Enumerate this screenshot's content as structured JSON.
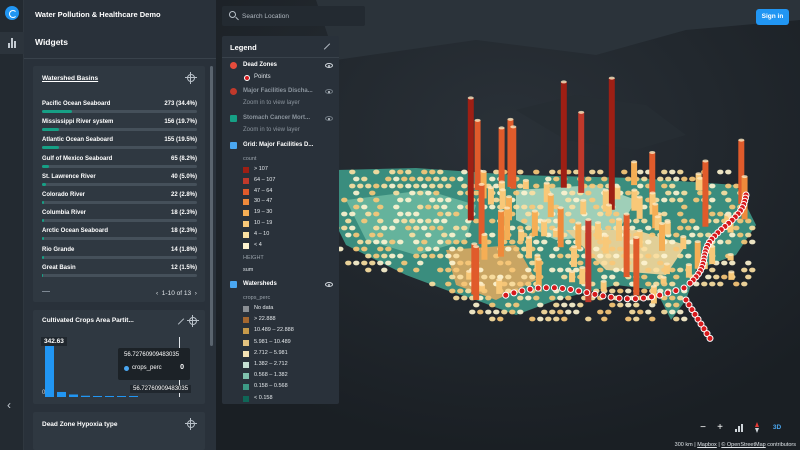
{
  "app": {
    "title": "Water Pollution & Healthcare Demo",
    "widgets_title": "Widgets"
  },
  "rail": {
    "collapse_icon": "chevron-left-icon"
  },
  "watershed": {
    "title": "Watershed Basins",
    "rows": [
      {
        "name": "Pacific Ocean Seaboard",
        "value": "273 (34.4%)",
        "fraction": 0.344
      },
      {
        "name": "Mississippi River system",
        "value": "156 (19.7%)",
        "fraction": 0.197
      },
      {
        "name": "Atlantic Ocean Seaboard",
        "value": "155 (19.5%)",
        "fraction": 0.195
      },
      {
        "name": "Gulf of Mexico Seaboard",
        "value": "65 (8.2%)",
        "fraction": 0.082
      },
      {
        "name": "St. Lawrence River",
        "value": "40 (5.0%)",
        "fraction": 0.05
      },
      {
        "name": "Colorado River",
        "value": "22 (2.8%)",
        "fraction": 0.028
      },
      {
        "name": "Columbia River",
        "value": "18 (2.3%)",
        "fraction": 0.023
      },
      {
        "name": "Arctic Ocean Seaboard",
        "value": "18 (2.3%)",
        "fraction": 0.023
      },
      {
        "name": "Rio Grande",
        "value": "14 (1.8%)",
        "fraction": 0.018
      },
      {
        "name": "Great Basin",
        "value": "12 (1.5%)",
        "fraction": 0.015
      }
    ],
    "pager": "1-10 of 13",
    "prev": "‹",
    "next": "›"
  },
  "cultivated": {
    "title": "Cultivated Crops Area Partit...",
    "max_label": "342.63",
    "min_label": "0",
    "histogram": [
      0.62,
      0.06,
      0.03,
      0.015,
      0.01,
      0.006,
      0.004,
      0.003
    ],
    "tooltip_title": "56.72760909483035",
    "tooltip_series": "crops_perc",
    "tooltip_value": "0",
    "cursor_label": "56.72760909483035"
  },
  "dead_zone": {
    "title": "Dead Zone Hypoxia type"
  },
  "search": {
    "placeholder": "Search Location"
  },
  "signin": "Sign in",
  "legend": {
    "title": "Legend",
    "dead_zones": {
      "name": "Dead Zones",
      "point_label": "Points",
      "color": "#d7191c"
    },
    "major_facilities": {
      "name": "Major Facilities Discha...",
      "note": "Zoom in to view layer"
    },
    "stomach_cancer": {
      "name": "Stomach Cancer Mort...",
      "note": "Zoom in to view layer"
    },
    "grid": {
      "name": "Grid: Major Facilities D...",
      "count_label": "count",
      "height_label": "HEIGHT",
      "height_value": "sum",
      "bins": [
        {
          "label": "> 107",
          "color": "#9e1f14"
        },
        {
          "label": "64 – 107",
          "color": "#c0392b"
        },
        {
          "label": "47 – 64",
          "color": "#e05b2b"
        },
        {
          "label": "30 – 47",
          "color": "#ef8a3b"
        },
        {
          "label": "19 – 30",
          "color": "#f5ae55"
        },
        {
          "label": "10 – 19",
          "color": "#f8c878"
        },
        {
          "label": "4 – 10",
          "color": "#fbe0a2"
        },
        {
          "label": "< 4",
          "color": "#fdf3cf"
        }
      ]
    },
    "watersheds": {
      "name": "Watersheds",
      "field": "crops_perc",
      "bins": [
        {
          "label": "No data",
          "color": "#8a8f94"
        },
        {
          "label": "> 22.888",
          "color": "#a4672f"
        },
        {
          "label": "10.489 – 22.888",
          "color": "#c79a4a"
        },
        {
          "label": "5.981 – 10.489",
          "color": "#e2c27f"
        },
        {
          "label": "2.712 – 5.981",
          "color": "#f3e2b5"
        },
        {
          "label": "1.382 – 2.712",
          "color": "#c6e1d4"
        },
        {
          "label": "0.568 – 1.382",
          "color": "#7fc1ad"
        },
        {
          "label": "0.158 – 0.568",
          "color": "#3d9a85"
        },
        {
          "label": "< 0.158",
          "color": "#0f6657"
        }
      ]
    }
  },
  "controls": {
    "zoom_out": "−",
    "zoom_in": "+",
    "mode_3d": "3D"
  },
  "attribution": {
    "scale": "300 km",
    "mapbox": "Mapbox",
    "osm": "© OpenStreetMap",
    "suffix": "contributors"
  }
}
